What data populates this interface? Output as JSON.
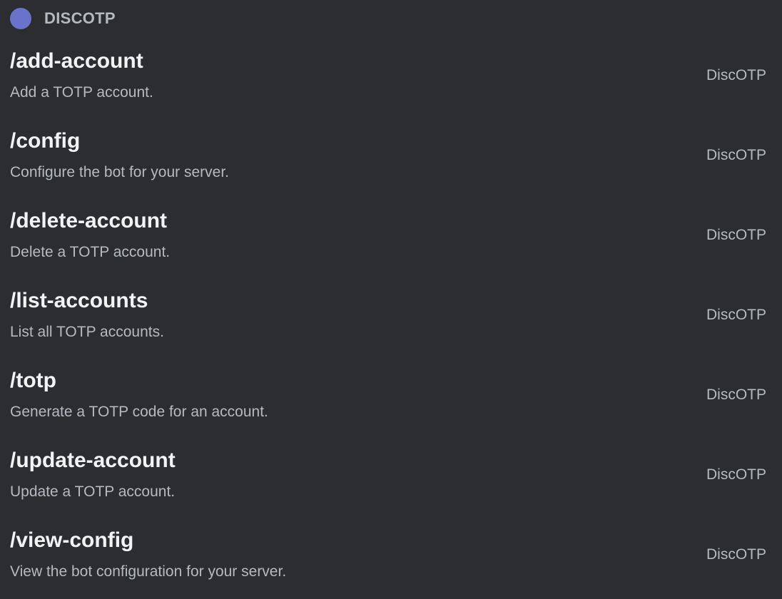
{
  "header": {
    "bot_name": "DISCOTP",
    "avatar_color": "#6873c9"
  },
  "commands": [
    {
      "name": "/add-account",
      "description": "Add a TOTP account.",
      "source": "DiscOTP"
    },
    {
      "name": "/config",
      "description": "Configure the bot for your server.",
      "source": "DiscOTP"
    },
    {
      "name": "/delete-account",
      "description": "Delete a TOTP account.",
      "source": "DiscOTP"
    },
    {
      "name": "/list-accounts",
      "description": "List all TOTP accounts.",
      "source": "DiscOTP"
    },
    {
      "name": "/totp",
      "description": "Generate a TOTP code for an account.",
      "source": "DiscOTP"
    },
    {
      "name": "/update-account",
      "description": "Update a TOTP account.",
      "source": "DiscOTP"
    },
    {
      "name": "/view-config",
      "description": "View the bot configuration for your server.",
      "source": "DiscOTP"
    }
  ]
}
